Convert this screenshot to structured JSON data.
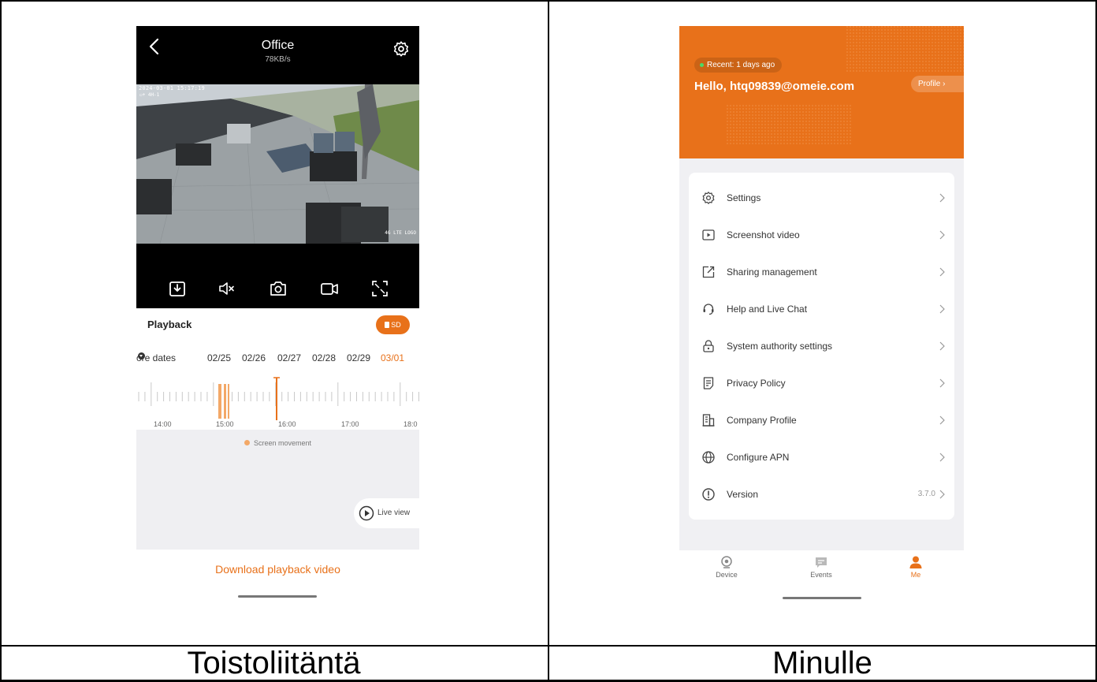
{
  "captions": {
    "left": "Toistoliitäntä",
    "right": "Minulle"
  },
  "playback_screen": {
    "title": "Office",
    "bitrate": "78KB/s",
    "osd_timestamp": "2024-03-01 15:17:19",
    "osd_battery": "▭+ 4H-1",
    "osd_corner": "4G LTE  LOGO",
    "controls": [
      "download-icon",
      "mute-icon",
      "snapshot-icon",
      "record-icon",
      "fullscreen-icon"
    ],
    "playback_label": "Playback",
    "sd_label": "SD",
    "more_dates_label": "ore dates",
    "dates": [
      "02/25",
      "02/26",
      "02/27",
      "02/28",
      "02/29",
      "03/01"
    ],
    "selected_date": "03/01",
    "timeline_ticks": [
      "14:00",
      "15:00",
      "16:00",
      "17:00",
      "18:0"
    ],
    "legend_label": "Screen movement",
    "live_view_label": "Live view",
    "download_label": "Download playback video",
    "colors": {
      "accent": "#e8711a",
      "event": "#f3a867"
    }
  },
  "me_screen": {
    "recent_label": "Recent: 1 days ago",
    "greeting": "Hello, htq09839@omeie.com",
    "profile_label": "Profile",
    "menu": [
      {
        "label": "Settings",
        "icon": "gear-icon"
      },
      {
        "label": "Screenshot video",
        "icon": "video-file-icon"
      },
      {
        "label": "Sharing management",
        "icon": "share-icon"
      },
      {
        "label": "Help and Live Chat",
        "icon": "headset-icon"
      },
      {
        "label": "System authority settings",
        "icon": "lock-icon"
      },
      {
        "label": "Privacy Policy",
        "icon": "document-icon"
      },
      {
        "label": "Company Profile",
        "icon": "building-icon"
      },
      {
        "label": "Configure APN",
        "icon": "globe-icon"
      },
      {
        "label": "Version",
        "icon": "info-icon",
        "value": "3.7.0"
      }
    ],
    "tabs": [
      {
        "label": "Device",
        "icon": "camera-icon"
      },
      {
        "label": "Events",
        "icon": "message-icon"
      },
      {
        "label": "Me",
        "icon": "person-icon",
        "active": true
      }
    ],
    "colors": {
      "accent": "#e8711a"
    }
  }
}
